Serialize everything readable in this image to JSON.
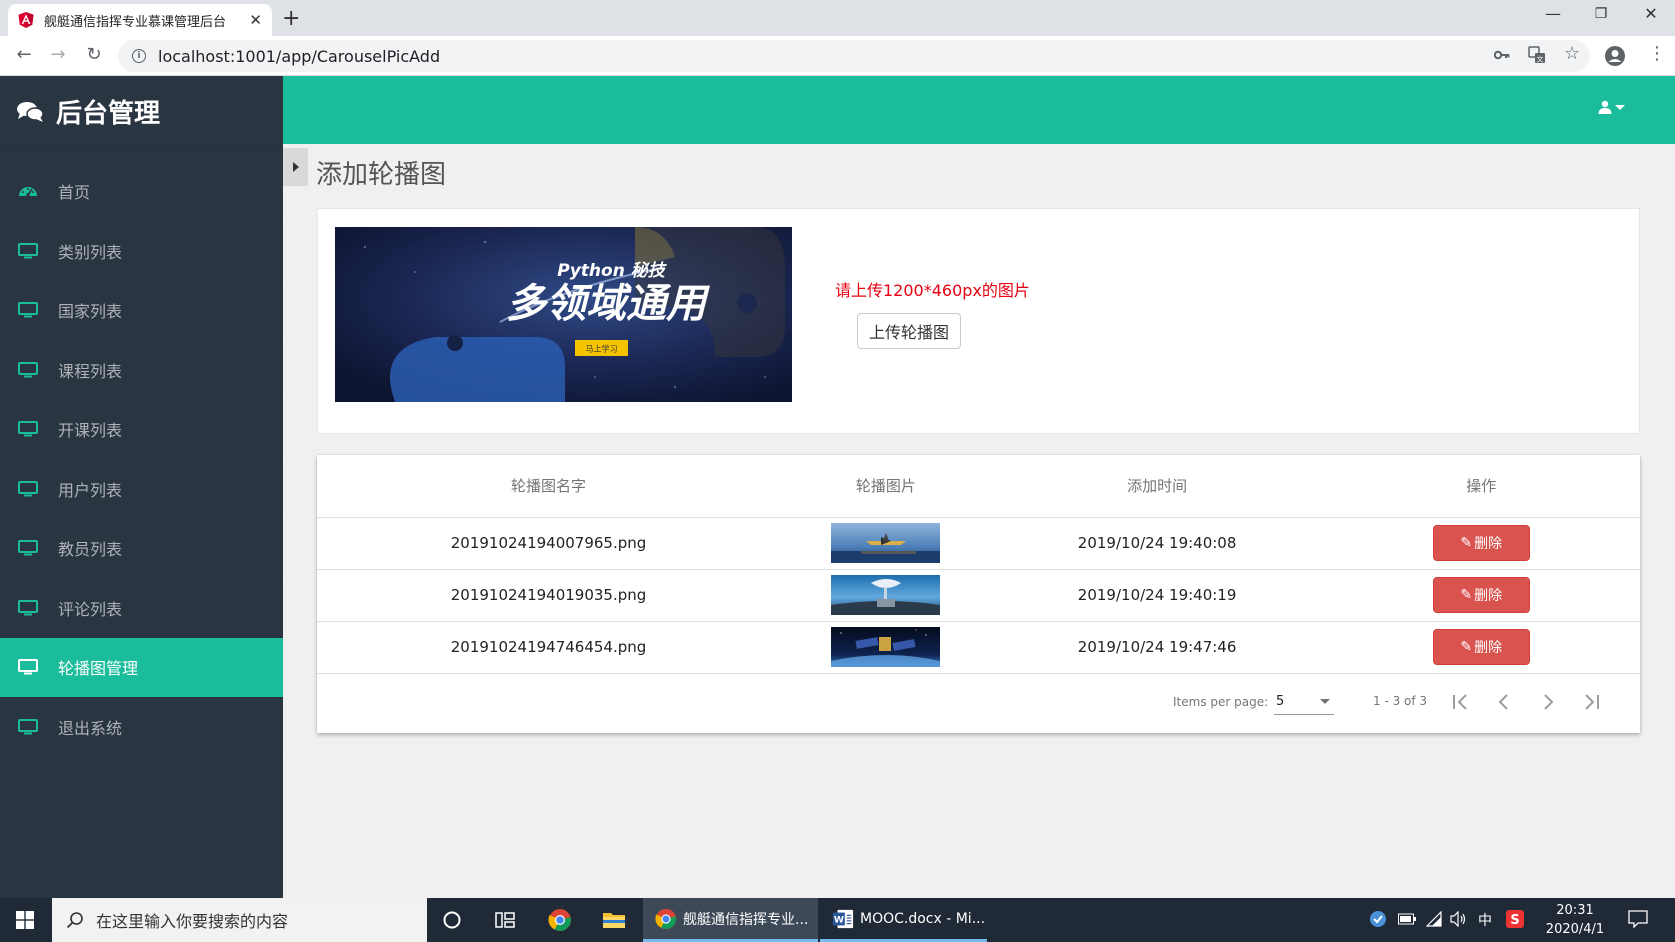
{
  "browser": {
    "tab_title": "舰艇通信指挥专业慕课管理后台",
    "url": "localhost:1001/app/CarouselPicAdd"
  },
  "sidebar": {
    "brand": "后台管理",
    "items": [
      {
        "label": "首页",
        "icon": "dashboard-icon",
        "active": false
      },
      {
        "label": "类别列表",
        "icon": "monitor-icon",
        "active": false
      },
      {
        "label": "国家列表",
        "icon": "monitor-icon",
        "active": false
      },
      {
        "label": "课程列表",
        "icon": "monitor-icon",
        "active": false
      },
      {
        "label": "开课列表",
        "icon": "monitor-icon",
        "active": false
      },
      {
        "label": "用户列表",
        "icon": "monitor-icon",
        "active": false
      },
      {
        "label": "教员列表",
        "icon": "monitor-icon",
        "active": false
      },
      {
        "label": "评论列表",
        "icon": "monitor-icon",
        "active": false
      },
      {
        "label": "轮播图管理",
        "icon": "monitor-icon",
        "active": true
      },
      {
        "label": "退出系统",
        "icon": "monitor-icon",
        "active": false
      }
    ]
  },
  "main": {
    "page_title": "添加轮播图",
    "upload": {
      "banner": {
        "headline": "Python 秘技",
        "main_text": "多领域通用",
        "cta": "马上学习"
      },
      "hint": "请上传1200*460px的图片",
      "button": "上传轮播图"
    },
    "table": {
      "headers": [
        "轮播图名字",
        "轮播图片",
        "添加时间",
        "操作"
      ],
      "rows": [
        {
          "name": "20191024194007965.png",
          "time": "2019/10/24 19:40:08",
          "action": "删除",
          "thumb": "aircraft-carrier-thumb"
        },
        {
          "name": "20191024194019035.png",
          "time": "2019/10/24 19:40:19",
          "action": "删除",
          "thumb": "radar-ship-thumb"
        },
        {
          "name": "20191024194746454.png",
          "time": "2019/10/24 19:47:46",
          "action": "删除",
          "thumb": "satellite-thumb"
        }
      ]
    },
    "paginator": {
      "items_per_page_label": "Items per page:",
      "page_size": "5",
      "range": "1 - 3 of 3"
    }
  },
  "taskbar": {
    "search_placeholder": "在这里输入你要搜索的内容",
    "apps": [
      {
        "label": "舰艇通信指挥专业...",
        "icon": "chrome-icon"
      },
      {
        "label": "MOOC.docx - Mi...",
        "icon": "word-icon"
      }
    ],
    "tray_ime": "中",
    "time": "20:31",
    "date": "2020/4/1"
  },
  "colors": {
    "accent": "#1abc9c",
    "sidebar_bg": "#2a3542",
    "danger": "#d9534f",
    "hint_red": "#e60012"
  }
}
